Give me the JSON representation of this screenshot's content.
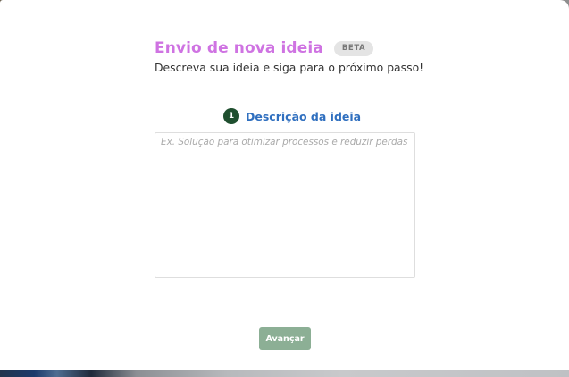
{
  "modal": {
    "title": "Envio de nova ideia",
    "badge": "BETA",
    "subtitle": "Descreva sua ideia e siga para o próximo passo!"
  },
  "step": {
    "number": "1",
    "label": "Descrição da ideia"
  },
  "idea_input": {
    "value": "",
    "placeholder": "Ex. Solução para otimizar processos e reduzir perdas"
  },
  "actions": {
    "next_label": "Avançar"
  },
  "colors": {
    "title": "#cf73e2",
    "step_label": "#2f6fbf",
    "step_badge": "#1f4f2f",
    "next_button": "#8caf95"
  }
}
